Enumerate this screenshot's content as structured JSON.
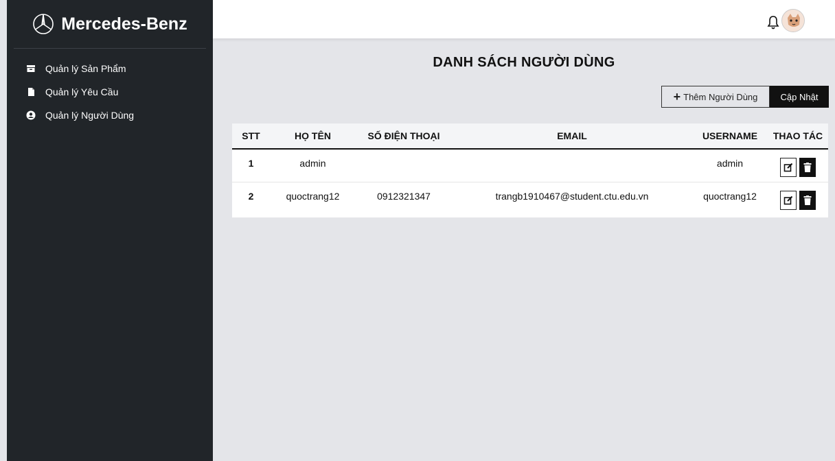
{
  "brand": {
    "name": "Mercedes-Benz",
    "logo_icon": "mercedes-star-icon"
  },
  "sidebar": {
    "items": [
      {
        "label": "Quản lý Sản Phẩm",
        "icon": "box-icon"
      },
      {
        "label": "Quản lý Yêu Cầu",
        "icon": "file-icon"
      },
      {
        "label": "Quản lý Người Dùng",
        "icon": "user-circle-icon"
      }
    ]
  },
  "topbar": {
    "bell_icon": "bell-icon",
    "avatar": "avatar"
  },
  "main": {
    "title": "DANH SÁCH NGƯỜI DÙNG",
    "add_label": "Thêm Người Dùng",
    "update_label": "Cập Nhật",
    "columns": [
      "STT",
      "HỌ TÊN",
      "SỐ ĐIỆN THOẠI",
      "EMAIL",
      "USERNAME",
      "THAO TÁC"
    ],
    "rows": [
      {
        "stt": "1",
        "name": "admin",
        "phone": "",
        "email": "",
        "username": "admin"
      },
      {
        "stt": "2",
        "name": "quoctrang12",
        "phone": "0912321347",
        "email": "trangb1910467@student.ctu.edu.vn",
        "username": "quoctrang12"
      }
    ]
  },
  "colors": {
    "sidebar_bg": "#212529",
    "content_bg": "#e4e5e9",
    "accent": "#111111"
  }
}
